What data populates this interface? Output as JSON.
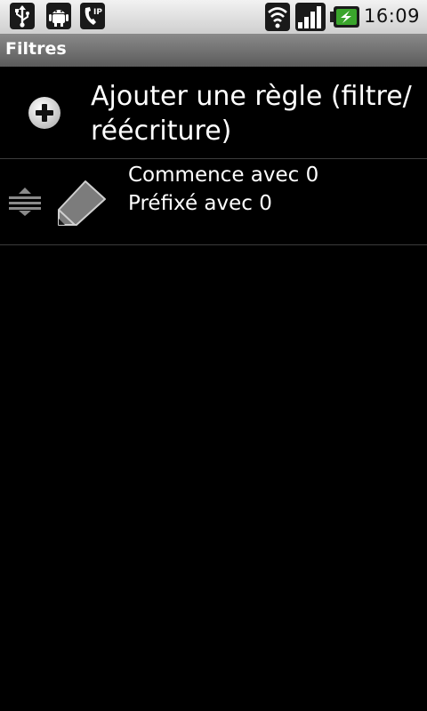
{
  "status_bar": {
    "time": "16:09",
    "left_icons": [
      "usb-icon",
      "android-debug-icon",
      "sip-call-icon"
    ],
    "right_icons": [
      "wifi-icon",
      "signal-icon",
      "battery-charging-icon"
    ],
    "accent_color": "#3aa52c"
  },
  "title_bar": {
    "title": "Filtres"
  },
  "add_rule": {
    "label": "Ajouter une règle (filtre/ réécriture)",
    "icon": "add-circle-icon"
  },
  "rules": [
    {
      "line1": "Commence avec 0",
      "line2": "Préfixé avec 0",
      "handle_icon": "drag-handle-icon",
      "edit_icon": "pencil-icon"
    }
  ]
}
